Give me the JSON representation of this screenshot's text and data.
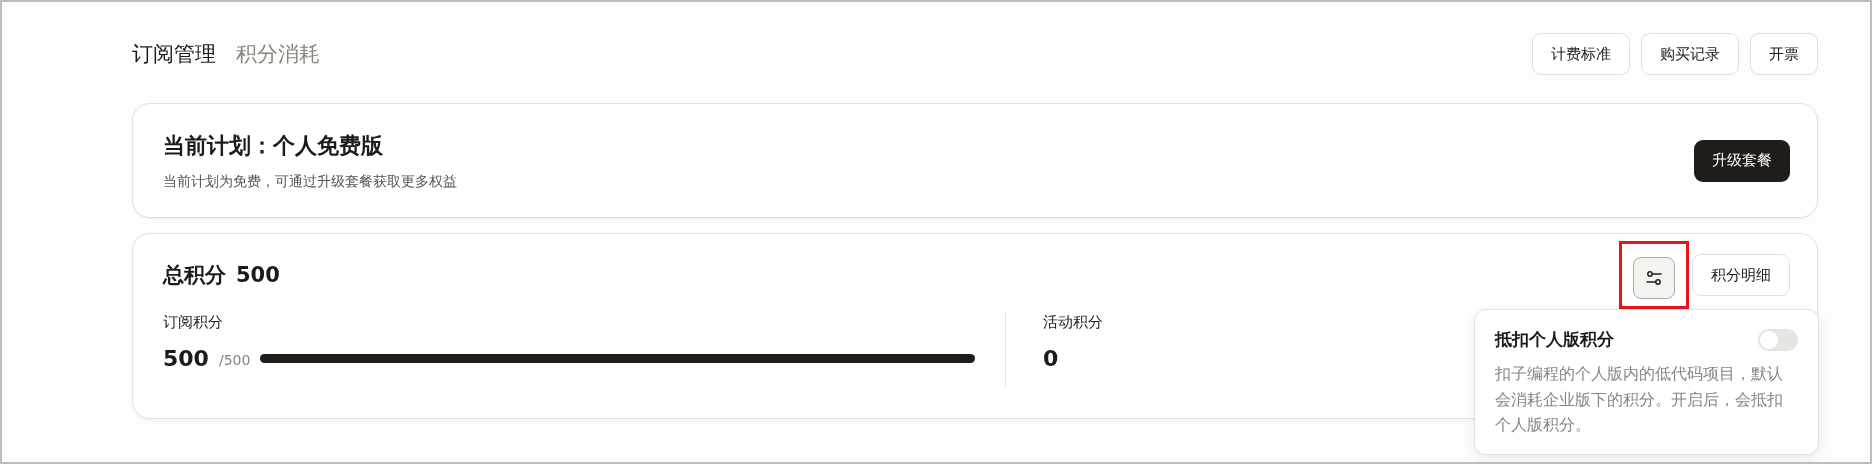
{
  "tabs": [
    {
      "label": "订阅管理",
      "selected": true
    },
    {
      "label": "积分消耗",
      "selected": false
    }
  ],
  "header_buttons": [
    "计费标准",
    "购买记录",
    "开票"
  ],
  "plan": {
    "title": "当前计划：个人免费版",
    "description": "当前计划为免费，可通过升级套餐获取更多权益",
    "button": "升级套餐"
  },
  "points": {
    "title": "总积分",
    "total": "500",
    "detail_button": "积分明细",
    "settings_highlighted": true,
    "subscription": {
      "label": "订阅积分",
      "value": "500",
      "max": "/500",
      "level": 1
    },
    "activity": {
      "label": "活动积分",
      "value": "0"
    }
  },
  "popover": {
    "title": "抵扣个人版积分",
    "on": false,
    "description": "扣子编程的个人版内的低代码项目，默认会消耗企业版下的积分。开启后，会抵扣个人版积分。"
  }
}
